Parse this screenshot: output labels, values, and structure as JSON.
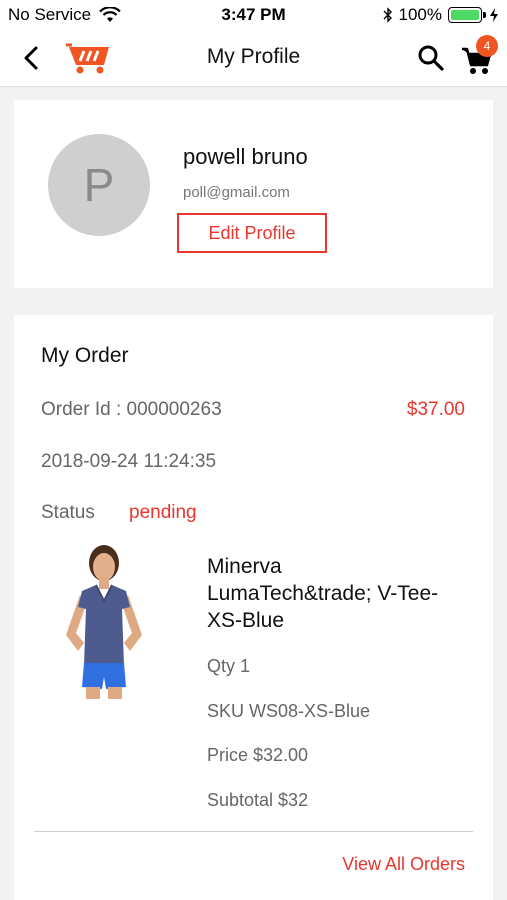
{
  "status_bar": {
    "carrier": "No Service",
    "time": "3:47 PM",
    "battery_percent": "100%"
  },
  "nav": {
    "title": "My Profile",
    "cart_count": "4",
    "icons": [
      "back-arrow-icon",
      "store-logo-icon",
      "search-icon",
      "cart-icon"
    ]
  },
  "profile": {
    "avatar_initial": "P",
    "name": "powell bruno",
    "email": "poll@gmail.com",
    "edit_label": "Edit Profile"
  },
  "order": {
    "heading": "My Order",
    "order_id": "Order Id : 000000263",
    "total": "$37.00",
    "date": "2018-09-24 11:24:35",
    "status_label": "Status",
    "status_value": "pending",
    "item": {
      "name": "Minerva LumaTech&trade; V-Tee-XS-Blue",
      "qty": "Qty 1",
      "sku": "SKU WS08-XS-Blue",
      "price": "Price $32.00",
      "subtotal": "Subtotal $32"
    },
    "view_all_label": "View All Orders"
  },
  "colors": {
    "accent": "#e8362e",
    "badge": "#f05522",
    "battery": "#4cd964"
  }
}
